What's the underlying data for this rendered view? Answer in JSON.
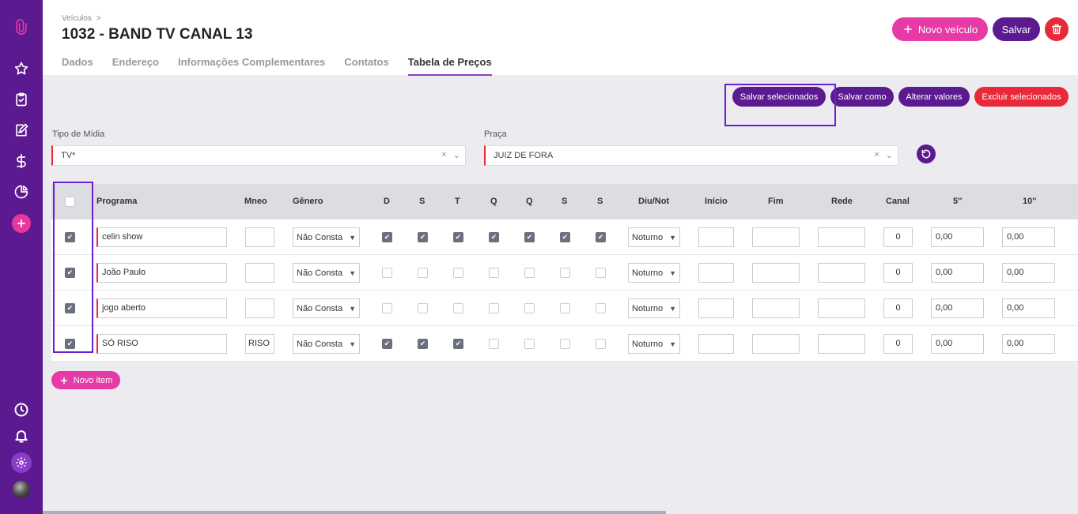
{
  "sidebar": {
    "icons": [
      "paperclip-icon",
      "star-icon",
      "clipboard-check-icon",
      "edit-icon",
      "dollar-icon",
      "pie-chart-icon",
      "plus-icon",
      "clock-icon",
      "bell-icon",
      "gear-icon",
      "avatar"
    ]
  },
  "header": {
    "breadcrumb": "Veículos",
    "breadcrumb_sep": ">",
    "title": "1032 - BAND TV CANAL 13",
    "new_vehicle_label": "Novo veículo",
    "save_label": "Salvar",
    "tabs": [
      {
        "label": "Dados",
        "active": false
      },
      {
        "label": "Endereço",
        "active": false
      },
      {
        "label": "Informações Complementares",
        "active": false
      },
      {
        "label": "Contatos",
        "active": false
      },
      {
        "label": "Tabela de Preços",
        "active": true
      }
    ]
  },
  "actions": {
    "save_selected": "Salvar selecionados",
    "save_as": "Salvar como",
    "change_values": "Alterar valores",
    "delete_selected": "Excluir selecionados"
  },
  "filters": {
    "media_type_label": "Tipo de Mídia",
    "media_type_value": "TV*",
    "place_label": "Praça",
    "place_value": "JUIZ DE FORA",
    "clear_glyph": "×"
  },
  "table": {
    "headers": {
      "programa": "Programa",
      "mneo": "Mneo",
      "genero": "Gênero",
      "d": "D",
      "s1": "S",
      "t": "T",
      "q1": "Q",
      "q2": "Q",
      "s2": "S",
      "s3": "S",
      "diu_not": "Diu/Not",
      "inicio": "Início",
      "fim": "Fim",
      "rede": "Rede",
      "canal": "Canal",
      "c5": "5''",
      "c10": "10''"
    },
    "rows": [
      {
        "selected": true,
        "programa": "celin show",
        "mneo": "",
        "genero": "Não Consta",
        "days": [
          true,
          true,
          true,
          true,
          true,
          true,
          true
        ],
        "diu_not": "Noturno",
        "inicio": "",
        "fim": "",
        "rede": "",
        "canal": "0",
        "c5": "0,00",
        "c10": "0,00"
      },
      {
        "selected": true,
        "programa": "João Paulo",
        "mneo": "",
        "genero": "Não Consta",
        "days": [
          false,
          false,
          false,
          false,
          false,
          false,
          false
        ],
        "diu_not": "Noturno",
        "inicio": "",
        "fim": "",
        "rede": "",
        "canal": "0",
        "c5": "0,00",
        "c10": "0,00"
      },
      {
        "selected": true,
        "programa": "jogo aberto",
        "mneo": "",
        "genero": "Não Consta",
        "days": [
          false,
          false,
          false,
          false,
          false,
          false,
          false
        ],
        "diu_not": "Noturno",
        "inicio": "",
        "fim": "",
        "rede": "",
        "canal": "0",
        "c5": "0,00",
        "c10": "0,00"
      },
      {
        "selected": true,
        "programa": "SÓ RISO",
        "mneo": "RISO",
        "genero": "Não Consta",
        "days": [
          true,
          true,
          true,
          false,
          false,
          false,
          false
        ],
        "diu_not": "Noturno",
        "inicio": "",
        "fim": "",
        "rede": "",
        "canal": "0",
        "c5": "0,00",
        "c10": "0,00"
      }
    ]
  },
  "new_item_label": "Novo item",
  "colors": {
    "sidebar": "#5b1a8f",
    "primary": "#5b1a8f",
    "pink": "#e63aa6",
    "danger": "#e8293a",
    "highlight": "#6a1fd0"
  }
}
